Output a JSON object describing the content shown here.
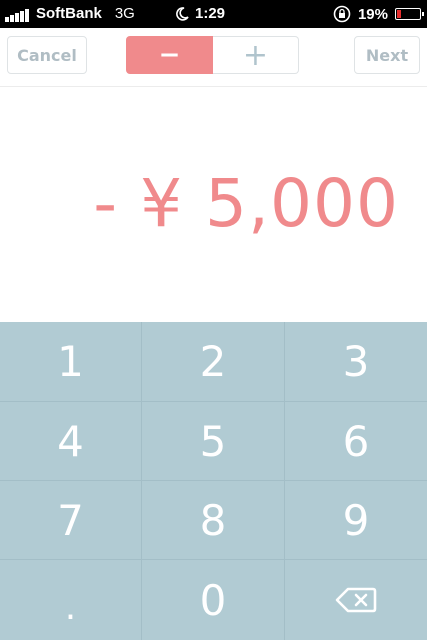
{
  "status_bar": {
    "carrier": "SoftBank",
    "network": "3G",
    "time": "1:29",
    "battery": "19%",
    "battery_level": 0.19
  },
  "nav": {
    "cancel_label": "Cancel",
    "minus_label": "−",
    "plus_label": "+",
    "next_label": "Next"
  },
  "amount": {
    "display": "- ¥ 5,000"
  },
  "keypad": {
    "keys": [
      "1",
      "2",
      "3",
      "4",
      "5",
      "6",
      "7",
      "8",
      "9",
      ".",
      "0"
    ]
  },
  "colors": {
    "accent": "#f08a8c",
    "keypad_bg": "#b1cbd3",
    "ghost_text": "#b0bdc4"
  }
}
